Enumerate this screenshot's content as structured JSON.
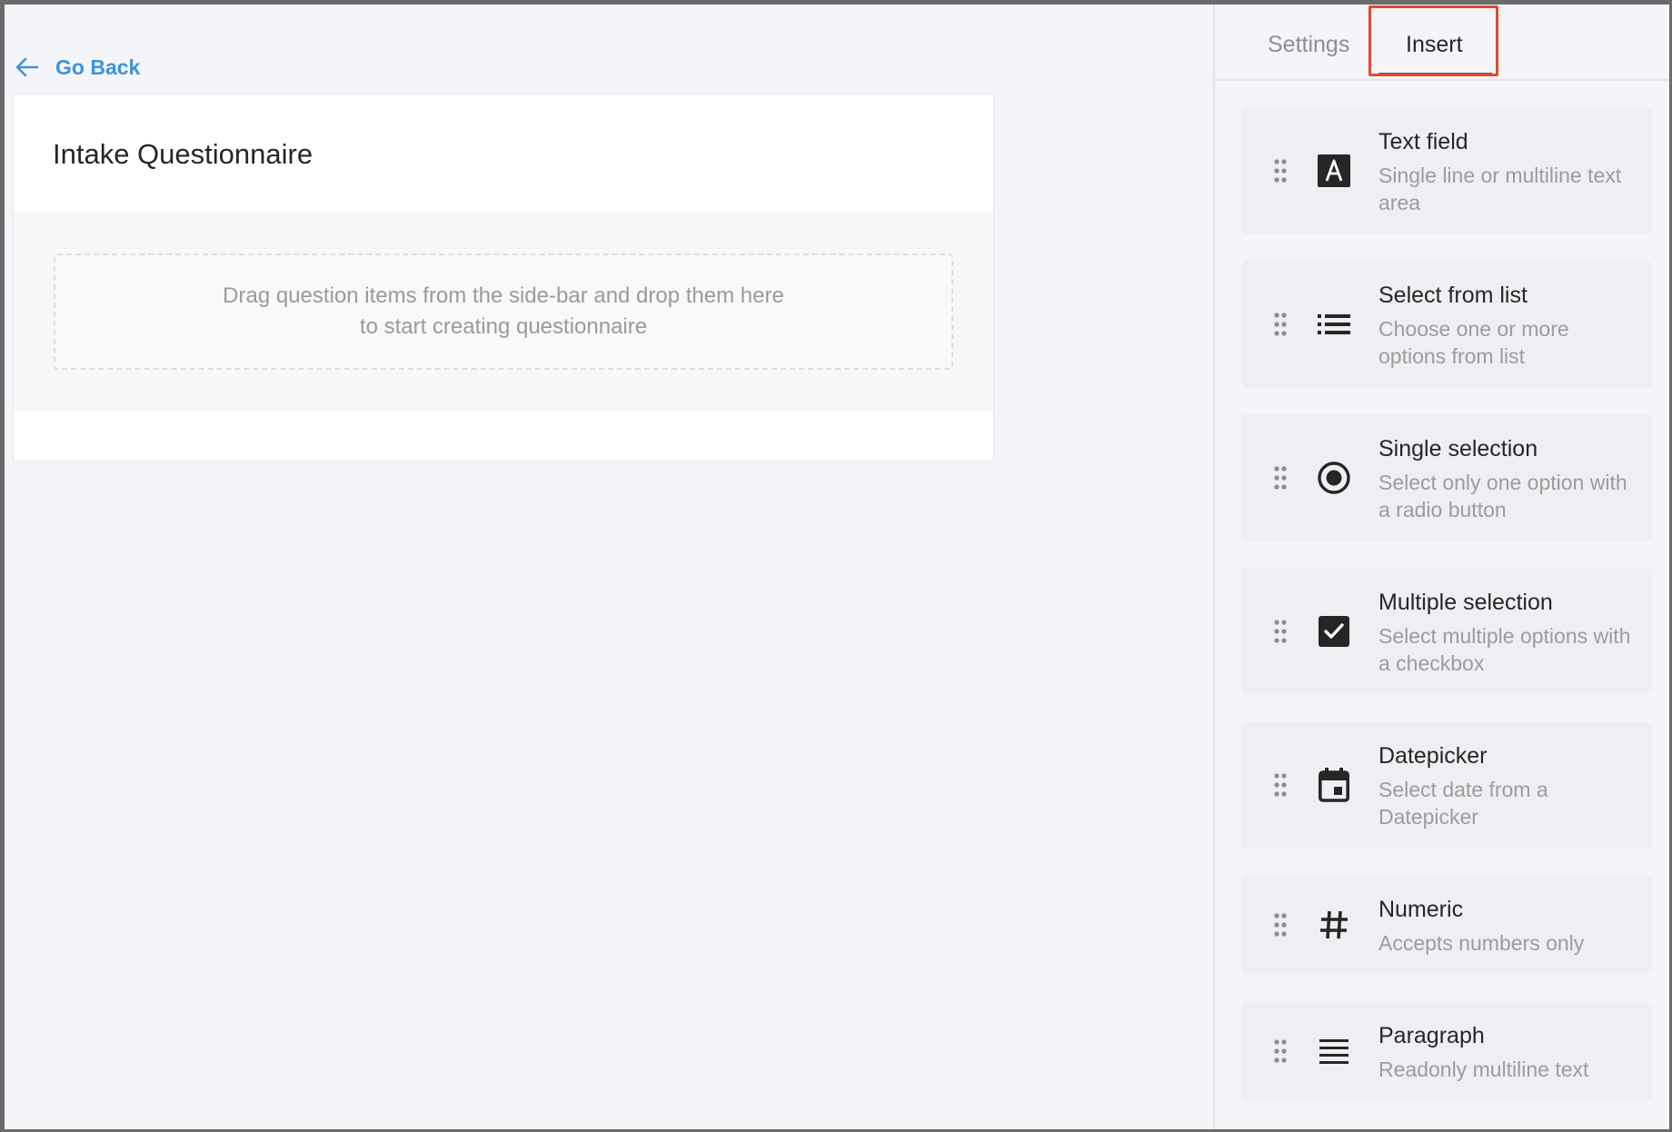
{
  "main": {
    "go_back_label": "Go Back",
    "card_title": "Intake Questionnaire",
    "drop_zone_text": "Drag question items from the side-bar and drop them here to start creating questionnaire"
  },
  "sidebar": {
    "tabs": [
      {
        "label": "Settings",
        "active": false
      },
      {
        "label": "Insert",
        "active": true
      }
    ],
    "items": [
      {
        "title": "Text field",
        "desc": "Single line or multiline text area",
        "icon": "text-field-icon"
      },
      {
        "title": "Select from list",
        "desc": "Choose one or more options from list",
        "icon": "list-icon"
      },
      {
        "title": "Single selection",
        "desc": "Select only one option with a radio button",
        "icon": "radio-button-icon"
      },
      {
        "title": "Multiple selection",
        "desc": "Select multiple options with a checkbox",
        "icon": "checkbox-icon"
      },
      {
        "title": "Datepicker",
        "desc": "Select date from a Datepicker",
        "icon": "calendar-icon"
      },
      {
        "title": "Numeric",
        "desc": "Accepts numbers only",
        "icon": "hash-icon"
      },
      {
        "title": "Paragraph",
        "desc": "Readonly multiline text",
        "icon": "paragraph-icon"
      }
    ]
  },
  "colors": {
    "accent": "#3d93dd",
    "highlight": "#e04a2e",
    "icon": "#262626"
  }
}
